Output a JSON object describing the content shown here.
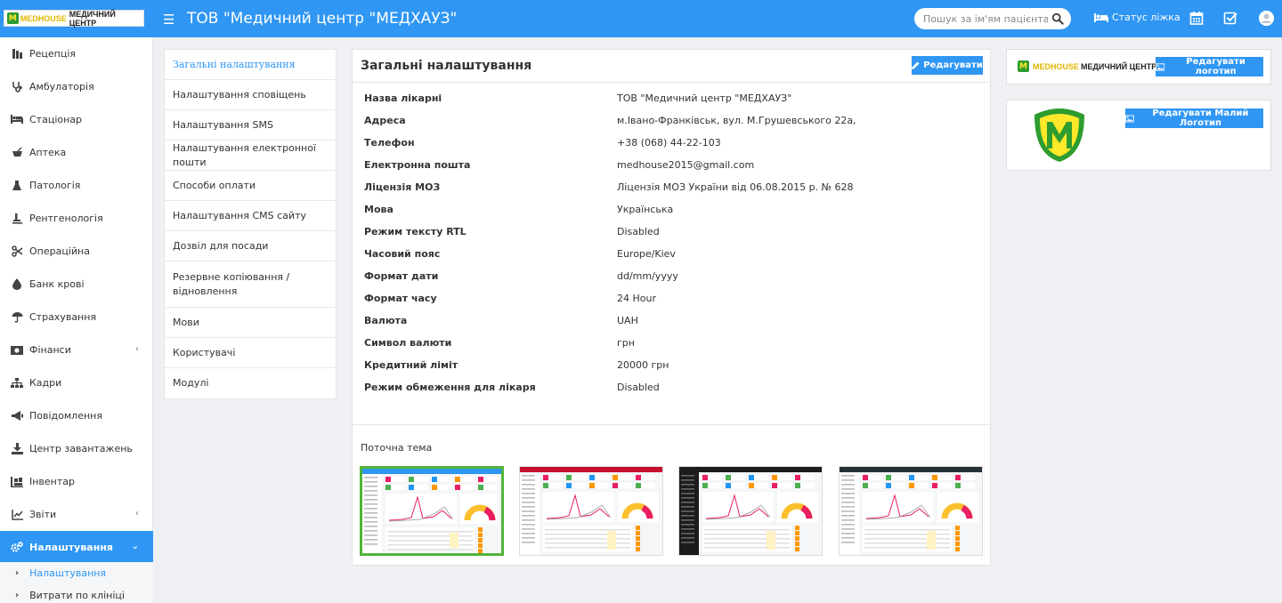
{
  "header": {
    "logo_word1": "MEDHOUSE",
    "logo_word2": "МЕДИЧНИЙ ЦЕНТР",
    "title": "ТОВ \"Медичний центр \"МЕДХАУЗ\"",
    "search_placeholder": "Пошук за ім'ям пацієнта",
    "bed_status_label": "Статус ліжка",
    "icons": [
      "menu-icon",
      "search-icon",
      "bed-icon",
      "calendar-icon",
      "checkbox-icon",
      "user-avatar-icon"
    ]
  },
  "sidebar": {
    "items": [
      {
        "label": "Рецепція",
        "icon": "reception-icon"
      },
      {
        "label": "Амбулаторія",
        "icon": "stethoscope-icon"
      },
      {
        "label": "Стаціонар",
        "icon": "hospital-bed-icon"
      },
      {
        "label": "Аптека",
        "icon": "pharmacy-icon"
      },
      {
        "label": "Патологія",
        "icon": "flask-icon"
      },
      {
        "label": "Рентгенологія",
        "icon": "xray-icon"
      },
      {
        "label": "Операційна",
        "icon": "scissors-icon"
      },
      {
        "label": "Банк крові",
        "icon": "blood-drop-icon"
      },
      {
        "label": "Страхування",
        "icon": "umbrella-icon"
      },
      {
        "label": "Фінанси",
        "icon": "money-icon"
      },
      {
        "label": "Кадри",
        "icon": "org-chart-icon"
      },
      {
        "label": "Повідомлення",
        "icon": "megaphone-icon"
      },
      {
        "label": "Центр завантажень",
        "icon": "download-icon"
      },
      {
        "label": "Інвентар",
        "icon": "inventory-icon"
      },
      {
        "label": "Звіти",
        "icon": "line-chart-icon"
      },
      {
        "label": "Налаштування",
        "icon": "cogs-icon"
      }
    ],
    "subitems": [
      {
        "label": "Налаштування"
      },
      {
        "label": "Витрати по клініці"
      }
    ]
  },
  "settings_menu": {
    "items": [
      {
        "label": "Загальні налаштування"
      },
      {
        "label": "Налаштування сповіщень"
      },
      {
        "label": "Налаштування SMS"
      },
      {
        "label": "Налаштування електронної пошти"
      },
      {
        "label": "Способи оплати"
      },
      {
        "label": "Налаштування CMS сайту"
      },
      {
        "label": "Дозвіл для посади"
      },
      {
        "label": "Резервне копіювання / відновлення"
      },
      {
        "label": "Мови"
      },
      {
        "label": "Користувачі"
      },
      {
        "label": "Модулі"
      }
    ]
  },
  "main": {
    "title": "Загальні налаштування",
    "edit_label": "Редагувати",
    "rows": [
      {
        "label": "Назва лікарні",
        "value": "ТОВ \"Медичний центр \"МЕДХАУЗ\""
      },
      {
        "label": "Адреса",
        "value": "м.Івано-Франківськ, вул. М.Грушевського 22а,"
      },
      {
        "label": "Телефон",
        "value": "+38 (068) 44-22-103"
      },
      {
        "label": "Електронна пошта",
        "value": "medhouse2015@gmail.com"
      },
      {
        "label": "Ліцензія МОЗ",
        "value": "Ліцензія МОЗ України від 06.08.2015 р. № 628"
      },
      {
        "label": "Мова",
        "value": "Українська"
      },
      {
        "label": "Режим тексту RTL",
        "value": "Disabled"
      },
      {
        "label": "Часовий пояс",
        "value": "Europe/Kiev"
      },
      {
        "label": "Формат дати",
        "value": "dd/mm/yyyy"
      },
      {
        "label": "Формат часу",
        "value": "24 Hour"
      },
      {
        "label": "Валюта",
        "value": "UAH"
      },
      {
        "label": "Символ валюти",
        "value": "грн"
      },
      {
        "label": "Кредитний ліміт",
        "value": "20000 грн"
      },
      {
        "label": "Режим обмеження для лікаря",
        "value": "Disabled"
      }
    ],
    "theme_label": "Поточна тема",
    "themes": [
      {
        "header": "#2f96f3",
        "sidebar": "#ffffff",
        "selected": true
      },
      {
        "header": "#c8102e",
        "sidebar": "#ffffff",
        "selected": false
      },
      {
        "header": "#1c1c1c",
        "sidebar": "#1c1c1c",
        "selected": false
      },
      {
        "header": "#263238",
        "sidebar": "#ffffff",
        "selected": false
      }
    ]
  },
  "logos": {
    "edit_logo_label": "Редагувати логотип",
    "edit_small_logo_label": "Редагувати Малий Логотип"
  },
  "colors": {
    "primary": "#2f96f3",
    "selected_theme_border": "#52b33a",
    "logo_green": "#2e9c2e",
    "logo_yellow": "#ffe82a"
  }
}
